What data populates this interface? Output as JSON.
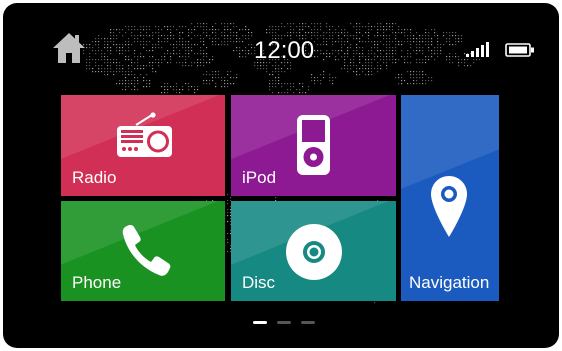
{
  "status_bar": {
    "time": "12:00",
    "home_icon": "home-icon",
    "signal_icon": "signal-bars-icon",
    "battery_icon": "battery-icon"
  },
  "tiles": {
    "radio": {
      "label": "Radio",
      "icon": "radio-icon",
      "color": "#d12f55"
    },
    "ipod": {
      "label": "iPod",
      "icon": "ipod-icon",
      "color": "#8e1a93"
    },
    "phone": {
      "label": "Phone",
      "icon": "phone-handset-icon",
      "color": "#199221"
    },
    "disc": {
      "label": "Disc",
      "icon": "disc-icon",
      "color": "#168983"
    },
    "navigation": {
      "label": "Navigation",
      "icon": "map-pin-icon",
      "color": "#1b5abf"
    }
  },
  "pager": {
    "pages": 3,
    "active_page": 1
  }
}
